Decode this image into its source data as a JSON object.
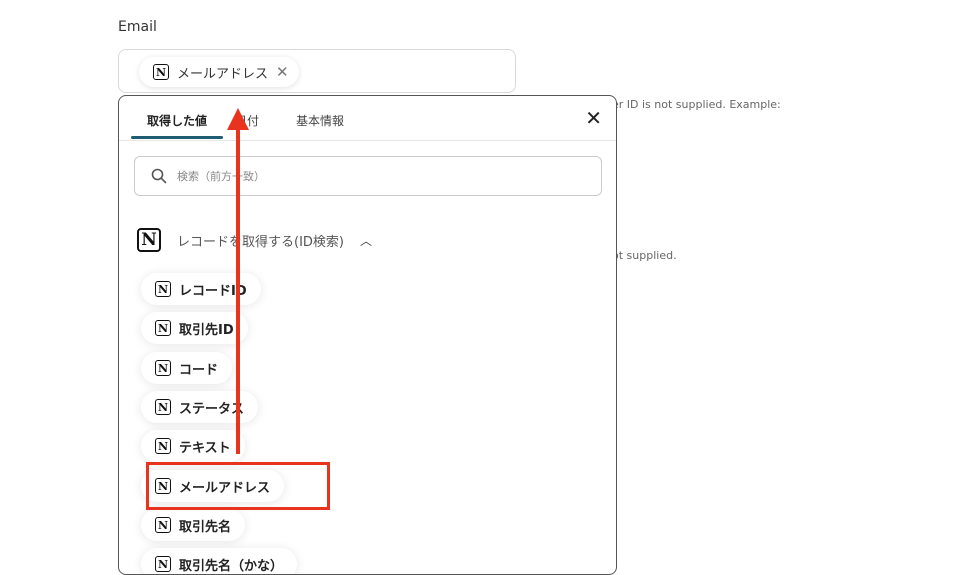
{
  "email_field": {
    "label": "Email",
    "chip_label": "メールアドレス",
    "chip_icon": "notion-icon",
    "remove_icon": "close-icon"
  },
  "background_hints": {
    "hint1": "er ID is not supplied. Example:",
    "hint2": "ot supplied."
  },
  "picker": {
    "tabs": [
      {
        "label": "取得した値",
        "active": true
      },
      {
        "label": "日付",
        "active": false
      },
      {
        "label": "基本情報",
        "active": false
      }
    ],
    "close_icon": "close-icon",
    "search": {
      "placeholder": "検索（前方一致）"
    },
    "section": {
      "title": "レコードを取得する(ID検索)",
      "icon": "notion-icon",
      "chevron": "chevron-up-icon"
    },
    "items": [
      {
        "label": "レコードID"
      },
      {
        "label": "取引先ID"
      },
      {
        "label": "コード"
      },
      {
        "label": "ステータス"
      },
      {
        "label": "テキスト"
      },
      {
        "label": "メールアドレス"
      },
      {
        "label": "取引先名"
      },
      {
        "label": "取引先名（かな）"
      }
    ]
  },
  "annotation": {
    "highlight_color": "#e8331f",
    "accent_color": "#1f5d73"
  }
}
